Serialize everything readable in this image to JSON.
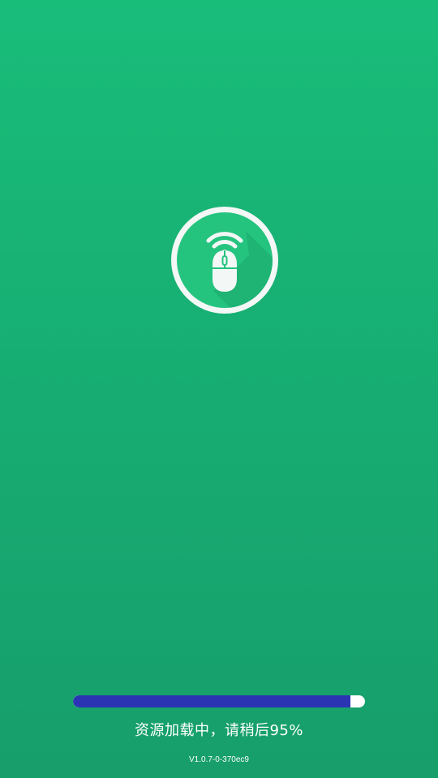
{
  "logo": {
    "icon": "wireless-mouse-icon"
  },
  "loading": {
    "progress_percent": 95,
    "status_text": "资源加载中，请稍后95%",
    "version_text": "V1.0.7-0-370ec9"
  },
  "colors": {
    "background_top": "#19bd7a",
    "background_bottom": "#179e6b",
    "progress_fill": "#2b35b3",
    "progress_track": "#ffffff"
  }
}
